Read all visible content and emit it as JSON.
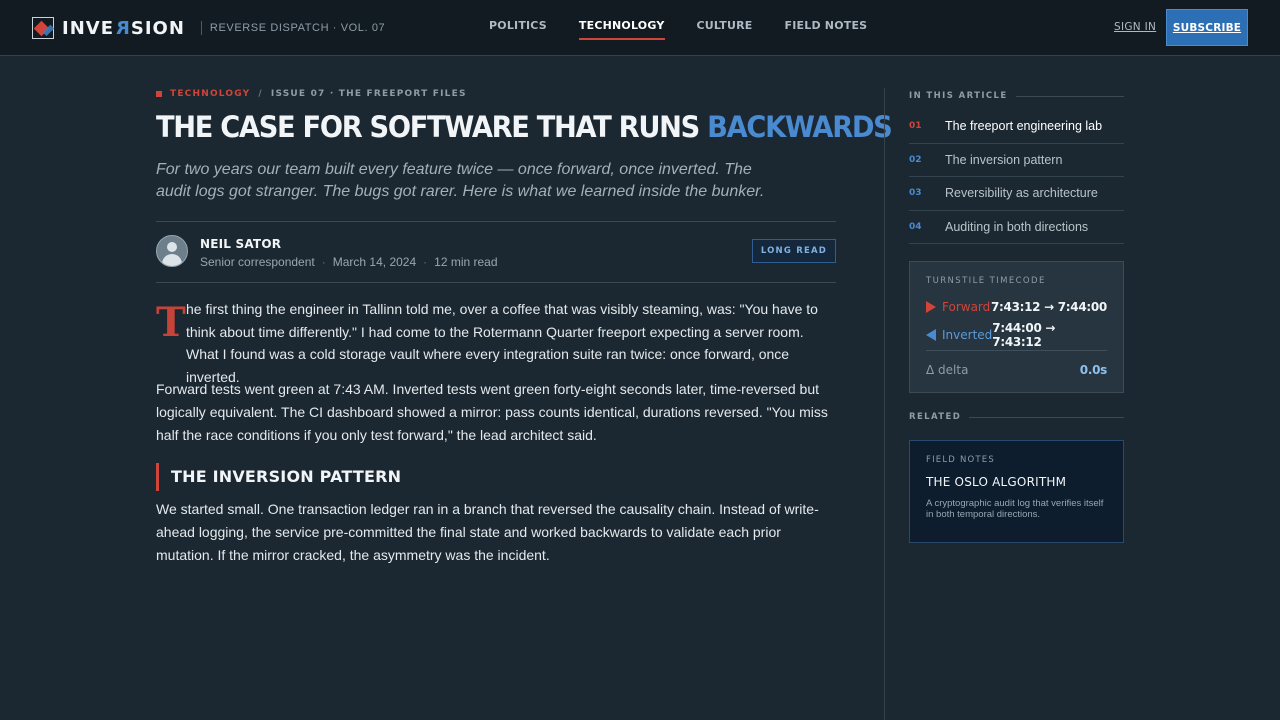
{
  "brand": {
    "name_pre": "INVE",
    "name_flip": "R",
    "name_post": "SION",
    "tagline": "REVERSE DISPATCH · VOL. 07"
  },
  "nav": {
    "items": [
      {
        "label": "POLITICS",
        "active": false
      },
      {
        "label": "TECHNOLOGY",
        "active": true
      },
      {
        "label": "CULTURE",
        "active": false
      },
      {
        "label": "FIELD NOTES",
        "active": false
      }
    ],
    "sign_in": "SIGN IN",
    "subscribe": "SUBSCRIBE"
  },
  "article": {
    "category": "TECHNOLOGY",
    "crumb_sep": "/",
    "issue": "ISSUE 07 · THE FREEPORT FILES",
    "headline_main": "THE CASE FOR SOFTWARE THAT RUNS ",
    "headline_accent": "BACKWARDS",
    "dek": "For two years our team built every feature twice — once forward, once inverted. The audit logs got stranger. The bugs got rarer. Here is what we learned inside the bunker.",
    "author": "NEIL SATOR",
    "role": "Senior correspondent",
    "date": "March 14, 2024",
    "read_time": "12 min read",
    "badge": "LONG READ",
    "dropcap": "T",
    "p1": "he first thing the engineer in Tallinn told me, over a coffee that was visibly steaming, was: \"You have to think about time differently.\" I had come to the Rotermann Quarter freeport expecting a server room. What I found was a cold storage vault where every integration suite ran twice: once forward, once inverted.",
    "p2": "Forward tests went green at 7:43 AM. Inverted tests went green forty-eight seconds later, time-reversed but logically equivalent. The CI dashboard showed a mirror: pass counts identical, durations reversed. \"You miss half the race conditions if you only test forward,\" the lead architect said.",
    "subhead": "THE INVERSION PATTERN",
    "p3": "We started small. One transaction ledger ran in a branch that reversed the causality chain. Instead of write-ahead logging, the service pre-committed the final state and worked backwards to validate each prior mutation. If the mirror cracked, the asymmetry was the incident."
  },
  "sidebar": {
    "toc_label": "IN THIS ARTICLE",
    "toc": [
      {
        "num": "01",
        "label": "The freeport engineering lab",
        "active": true
      },
      {
        "num": "02",
        "label": "The inversion pattern",
        "active": false
      },
      {
        "num": "03",
        "label": "Reversibility as architecture",
        "active": false
      },
      {
        "num": "04",
        "label": "Auditing in both directions",
        "active": false
      }
    ],
    "timecode": {
      "title": "TURNSTILE TIMECODE",
      "forward_label": "Forward",
      "forward_value": "7:43:12 → 7:44:00",
      "inverted_label": "Inverted",
      "inverted_value": "7:44:00 → 7:43:12",
      "delta_label": "Δ delta",
      "delta_value": "0.0s"
    },
    "related_label": "RELATED",
    "related": {
      "kicker": "FIELD NOTES",
      "title": "THE OSLO ALGORITHM",
      "desc": "A cryptographic audit log that verifies itself in both temporal directions."
    }
  },
  "colors": {
    "accent_red": "#d0443a",
    "accent_blue": "#4a8ad1",
    "background": "#1c2831",
    "topbar": "#121b22"
  }
}
